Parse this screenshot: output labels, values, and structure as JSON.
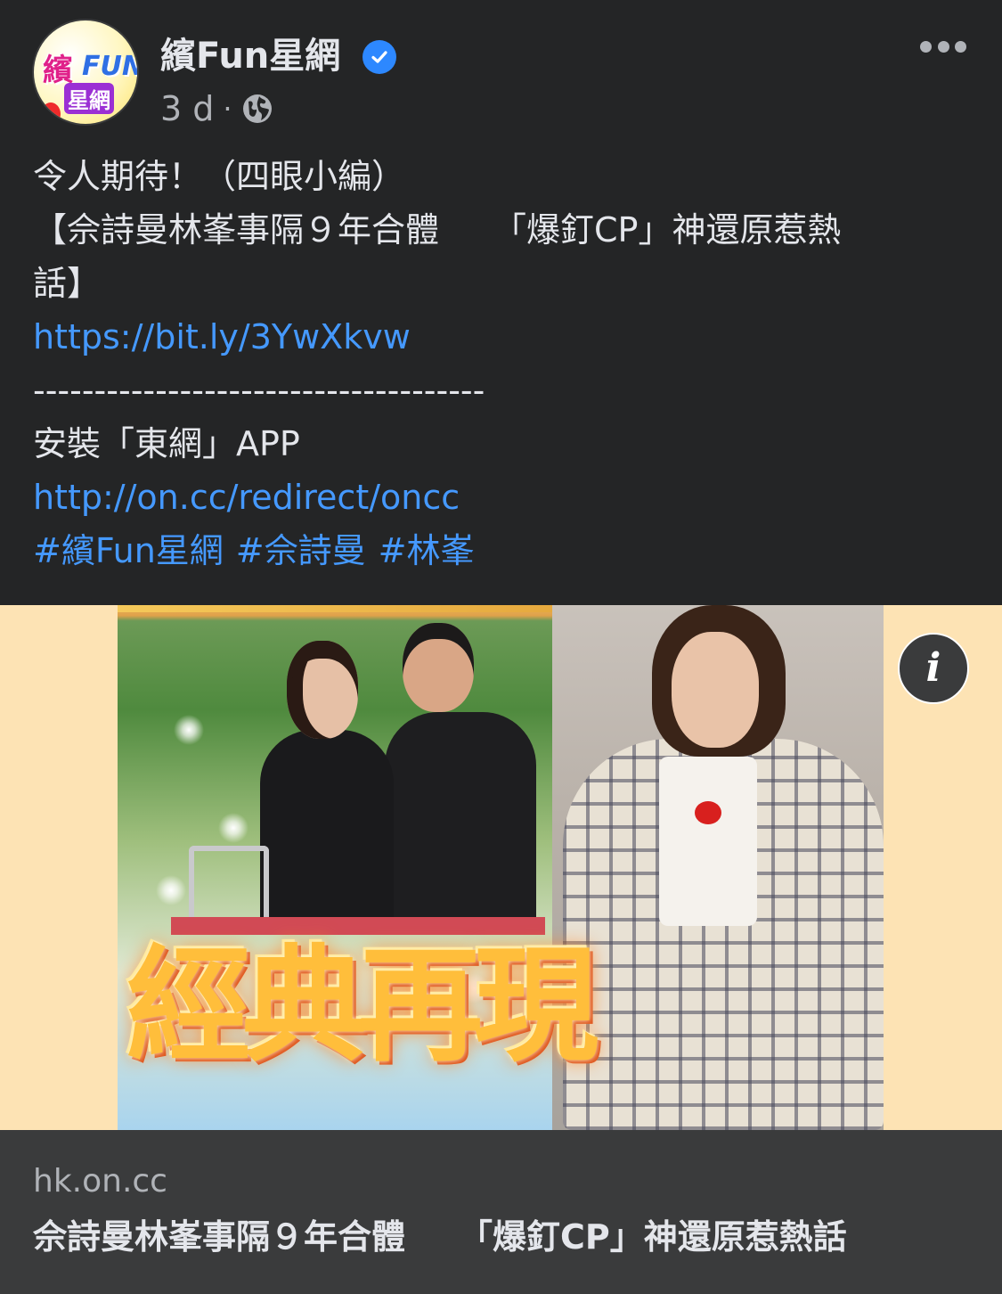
{
  "post": {
    "page_name": "繽Fun星網",
    "verified_icon": "verified-badge-icon",
    "time_ago": "3 d",
    "separator": "·",
    "audience_icon": "globe-icon",
    "more_icon": "more-options-icon"
  },
  "avatar": {
    "logo_line1": "繽",
    "logo_fun": "FUN",
    "logo_line2": "星網"
  },
  "body": {
    "line1": "令人期待！（四眼小編）",
    "headline_part1": "【佘詩曼林峯事隔９年合體",
    "headline_part2": "「爆釘CP」神還原惹熱",
    "headline_part3": "話】",
    "link1": "https://bit.ly/3YwXkvw",
    "divider": "-------------------------------------",
    "install_text": "安裝「東網」APP",
    "link2": "http://on.cc/redirect/oncc",
    "hashtags": [
      "#繽Fun星網",
      "#佘詩曼",
      "#林峯"
    ]
  },
  "media": {
    "overlay_title": "經典再現",
    "info_icon": "info-icon",
    "info_label": "i"
  },
  "link_preview": {
    "domain": "hk.on.cc",
    "title_part1": "佘詩曼林峯事隔９年合體",
    "title_part2": "「爆釘CP」神還原惹熱話"
  },
  "colors": {
    "background": "#242526",
    "text": "#e4e6eb",
    "secondary_text": "#b0b3b8",
    "link": "#4599ff",
    "verified": "#2d88ff",
    "preview_background": "#3a3b3c",
    "media_background": "#fde3b4"
  }
}
